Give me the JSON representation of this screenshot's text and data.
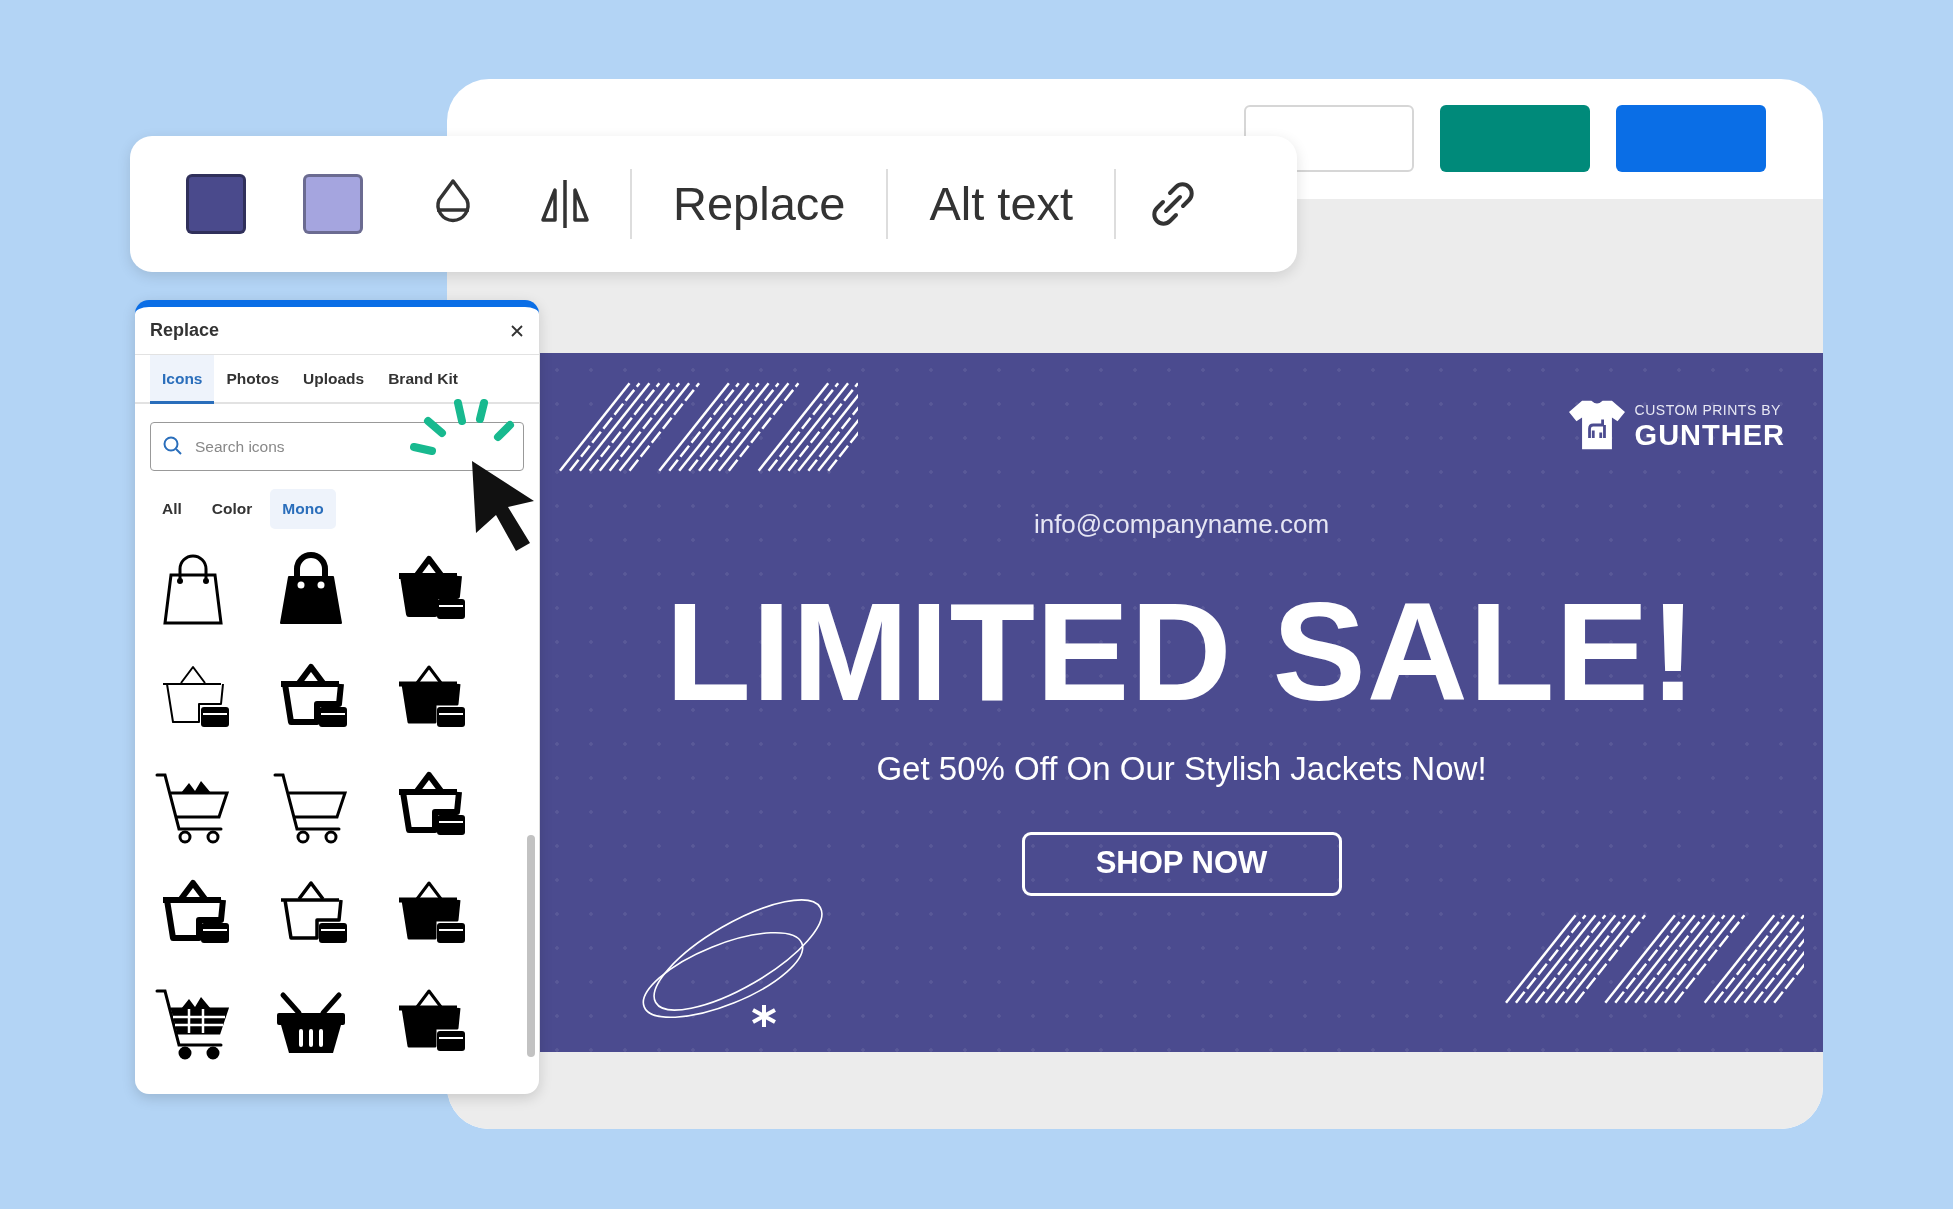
{
  "editor": {
    "header_buttons": [
      {
        "kind": "outline"
      },
      {
        "kind": "accent"
      },
      {
        "kind": "primary"
      }
    ]
  },
  "toolbar": {
    "swatches": [
      {
        "color": "#4a4a8c"
      },
      {
        "color": "#a5a5df"
      }
    ],
    "actions": [
      "Replace",
      "Alt text"
    ]
  },
  "panel": {
    "title": "Replace",
    "tabs": [
      {
        "label": "Icons",
        "selected": true
      },
      {
        "label": "Photos",
        "selected": false
      },
      {
        "label": "Uploads",
        "selected": false
      },
      {
        "label": "Brand Kit",
        "selected": false
      }
    ],
    "search": {
      "placeholder": "Search icons"
    },
    "filters": [
      {
        "label": "All",
        "selected": false
      },
      {
        "label": "Color",
        "selected": false
      },
      {
        "label": "Mono",
        "selected": true
      }
    ]
  },
  "banner": {
    "logo_top": "CUSTOM PRINTS BY",
    "logo_name": "GUNTHER",
    "email": "info@companyname.com",
    "headline": "LIMITED SALE!",
    "subheadline": "Get 50% Off On Our Stylish Jackets Now!",
    "cta": "SHOP NOW"
  }
}
